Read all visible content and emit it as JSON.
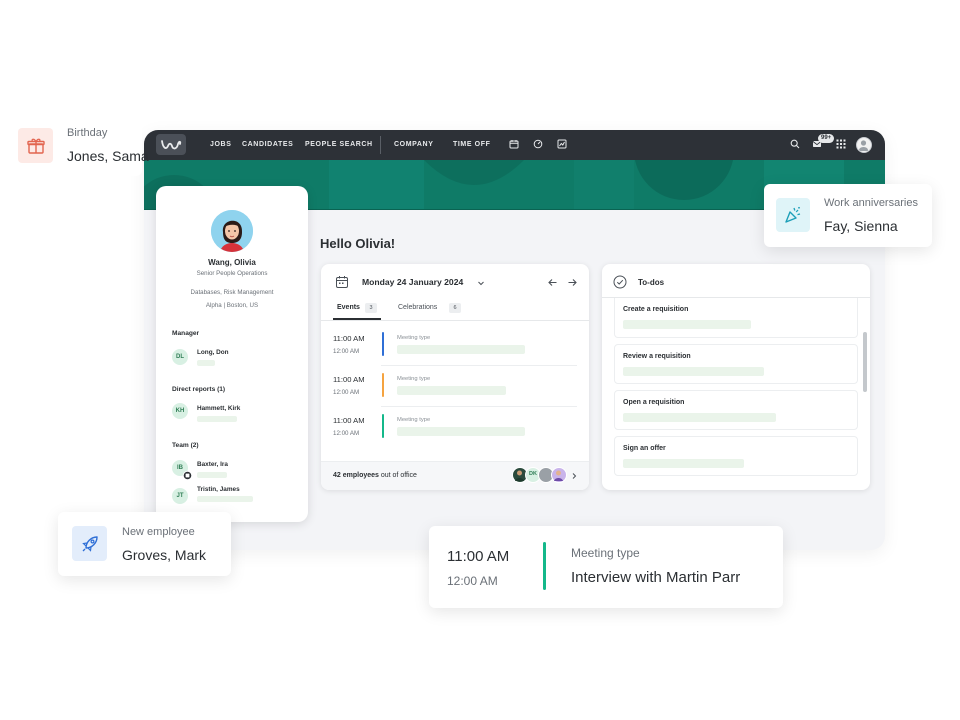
{
  "nav": {
    "links": [
      "JOBS",
      "CANDIDATES",
      "PEOPLE SEARCH",
      "COMPANY",
      "TIME OFF"
    ],
    "mail_badge": "99+"
  },
  "greeting": "Hello Olivia!",
  "profile": {
    "name": "Wang, Olivia",
    "title": "Senior People Operations",
    "skills": "Databases, Risk Management",
    "location": "Alpha | Boston, US",
    "manager_heading": "Manager",
    "manager": {
      "initials": "DL",
      "name": "Long, Don"
    },
    "direct_heading": "Direct reports  (1)",
    "direct": {
      "initials": "KH",
      "name": "Hammett, Kirk"
    },
    "team_heading": "Team (2)",
    "team": [
      {
        "initials": "IB",
        "name": "Baxter, Ira"
      },
      {
        "initials": "JT",
        "name": "Tristin, James"
      }
    ]
  },
  "events": {
    "date": "Monday 24 January 2024",
    "tabs": [
      {
        "label": "Events",
        "count": "3"
      },
      {
        "label": "Celebrations",
        "count": "6"
      }
    ],
    "items": [
      {
        "start": "11:00 AM",
        "end": "12:00 AM",
        "type": "Meeting type",
        "color": "#2f6fd6"
      },
      {
        "start": "11:00 AM",
        "end": "12:00 AM",
        "type": "Meeting type",
        "color": "#f5a340"
      },
      {
        "start": "11:00 AM",
        "end": "12:00 AM",
        "type": "Meeting type",
        "color": "#14b88a"
      }
    ],
    "ooo_count": "42 employees",
    "ooo_text": " out of office",
    "ooo_badge": "DK"
  },
  "todos": {
    "title": "To-dos",
    "items": [
      "Create a requisition",
      "Review a requisition",
      "Open a requisition",
      "Sign an offer"
    ]
  },
  "floats": {
    "birthday": {
      "label": "Birthday",
      "value": "Jones, Sama"
    },
    "anniversary": {
      "label": "Work anniversaries",
      "value": "Fay, Sienna"
    },
    "new_employee": {
      "label": "New employee",
      "value": "Groves, Mark"
    },
    "meeting": {
      "start": "11:00 AM",
      "end": "12:00 AM",
      "type": "Meeting type",
      "title": "Interview with Martin Parr"
    }
  },
  "colors": {
    "brand_teal": "#0f7b67",
    "nav_bg": "#2d3137",
    "accent_green": "#14b88a",
    "birthday_icon": "#e2644f",
    "anniversary_icon": "#1c9fb8",
    "new_employee_icon": "#2f6fd6"
  }
}
